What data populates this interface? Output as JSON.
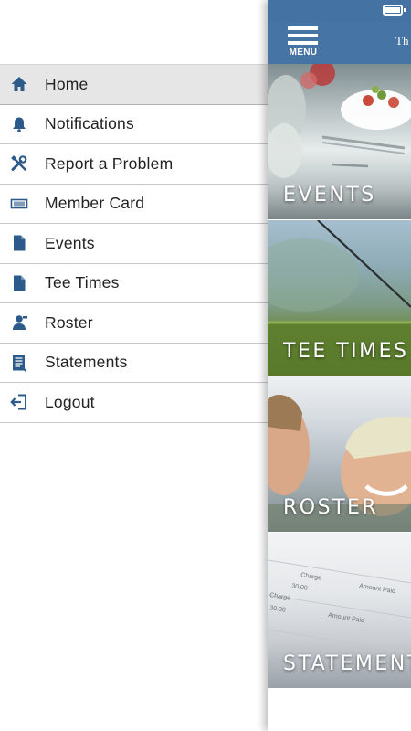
{
  "drawer": {
    "items": [
      {
        "label": "Home",
        "icon": "home-icon",
        "active": true
      },
      {
        "label": "Notifications",
        "icon": "bell-icon",
        "active": false
      },
      {
        "label": "Report a Problem",
        "icon": "tools-icon",
        "active": false
      },
      {
        "label": "Member Card",
        "icon": "card-icon",
        "active": false
      },
      {
        "label": "Events",
        "icon": "document-icon",
        "active": false
      },
      {
        "label": "Tee Times",
        "icon": "document-icon",
        "active": false
      },
      {
        "label": "Roster",
        "icon": "person-icon",
        "active": false
      },
      {
        "label": "Statements",
        "icon": "statement-icon",
        "active": false
      },
      {
        "label": "Logout",
        "icon": "logout-icon",
        "active": false
      }
    ]
  },
  "appbar": {
    "menu_label": "MENU",
    "title": "Th"
  },
  "tiles": [
    {
      "label": "EVENTS"
    },
    {
      "label": "TEE TIMES"
    },
    {
      "label": "ROSTER"
    },
    {
      "label": "STATEMENTS"
    }
  ],
  "statements_image_text": [
    "Charge",
    "Amount Paid",
    "30.00",
    "Charge",
    "Amount Paid",
    "30.00"
  ],
  "colors": {
    "accent": "#4675a5",
    "icon": "#2c5a8a",
    "active_row": "#e6e6e6"
  }
}
